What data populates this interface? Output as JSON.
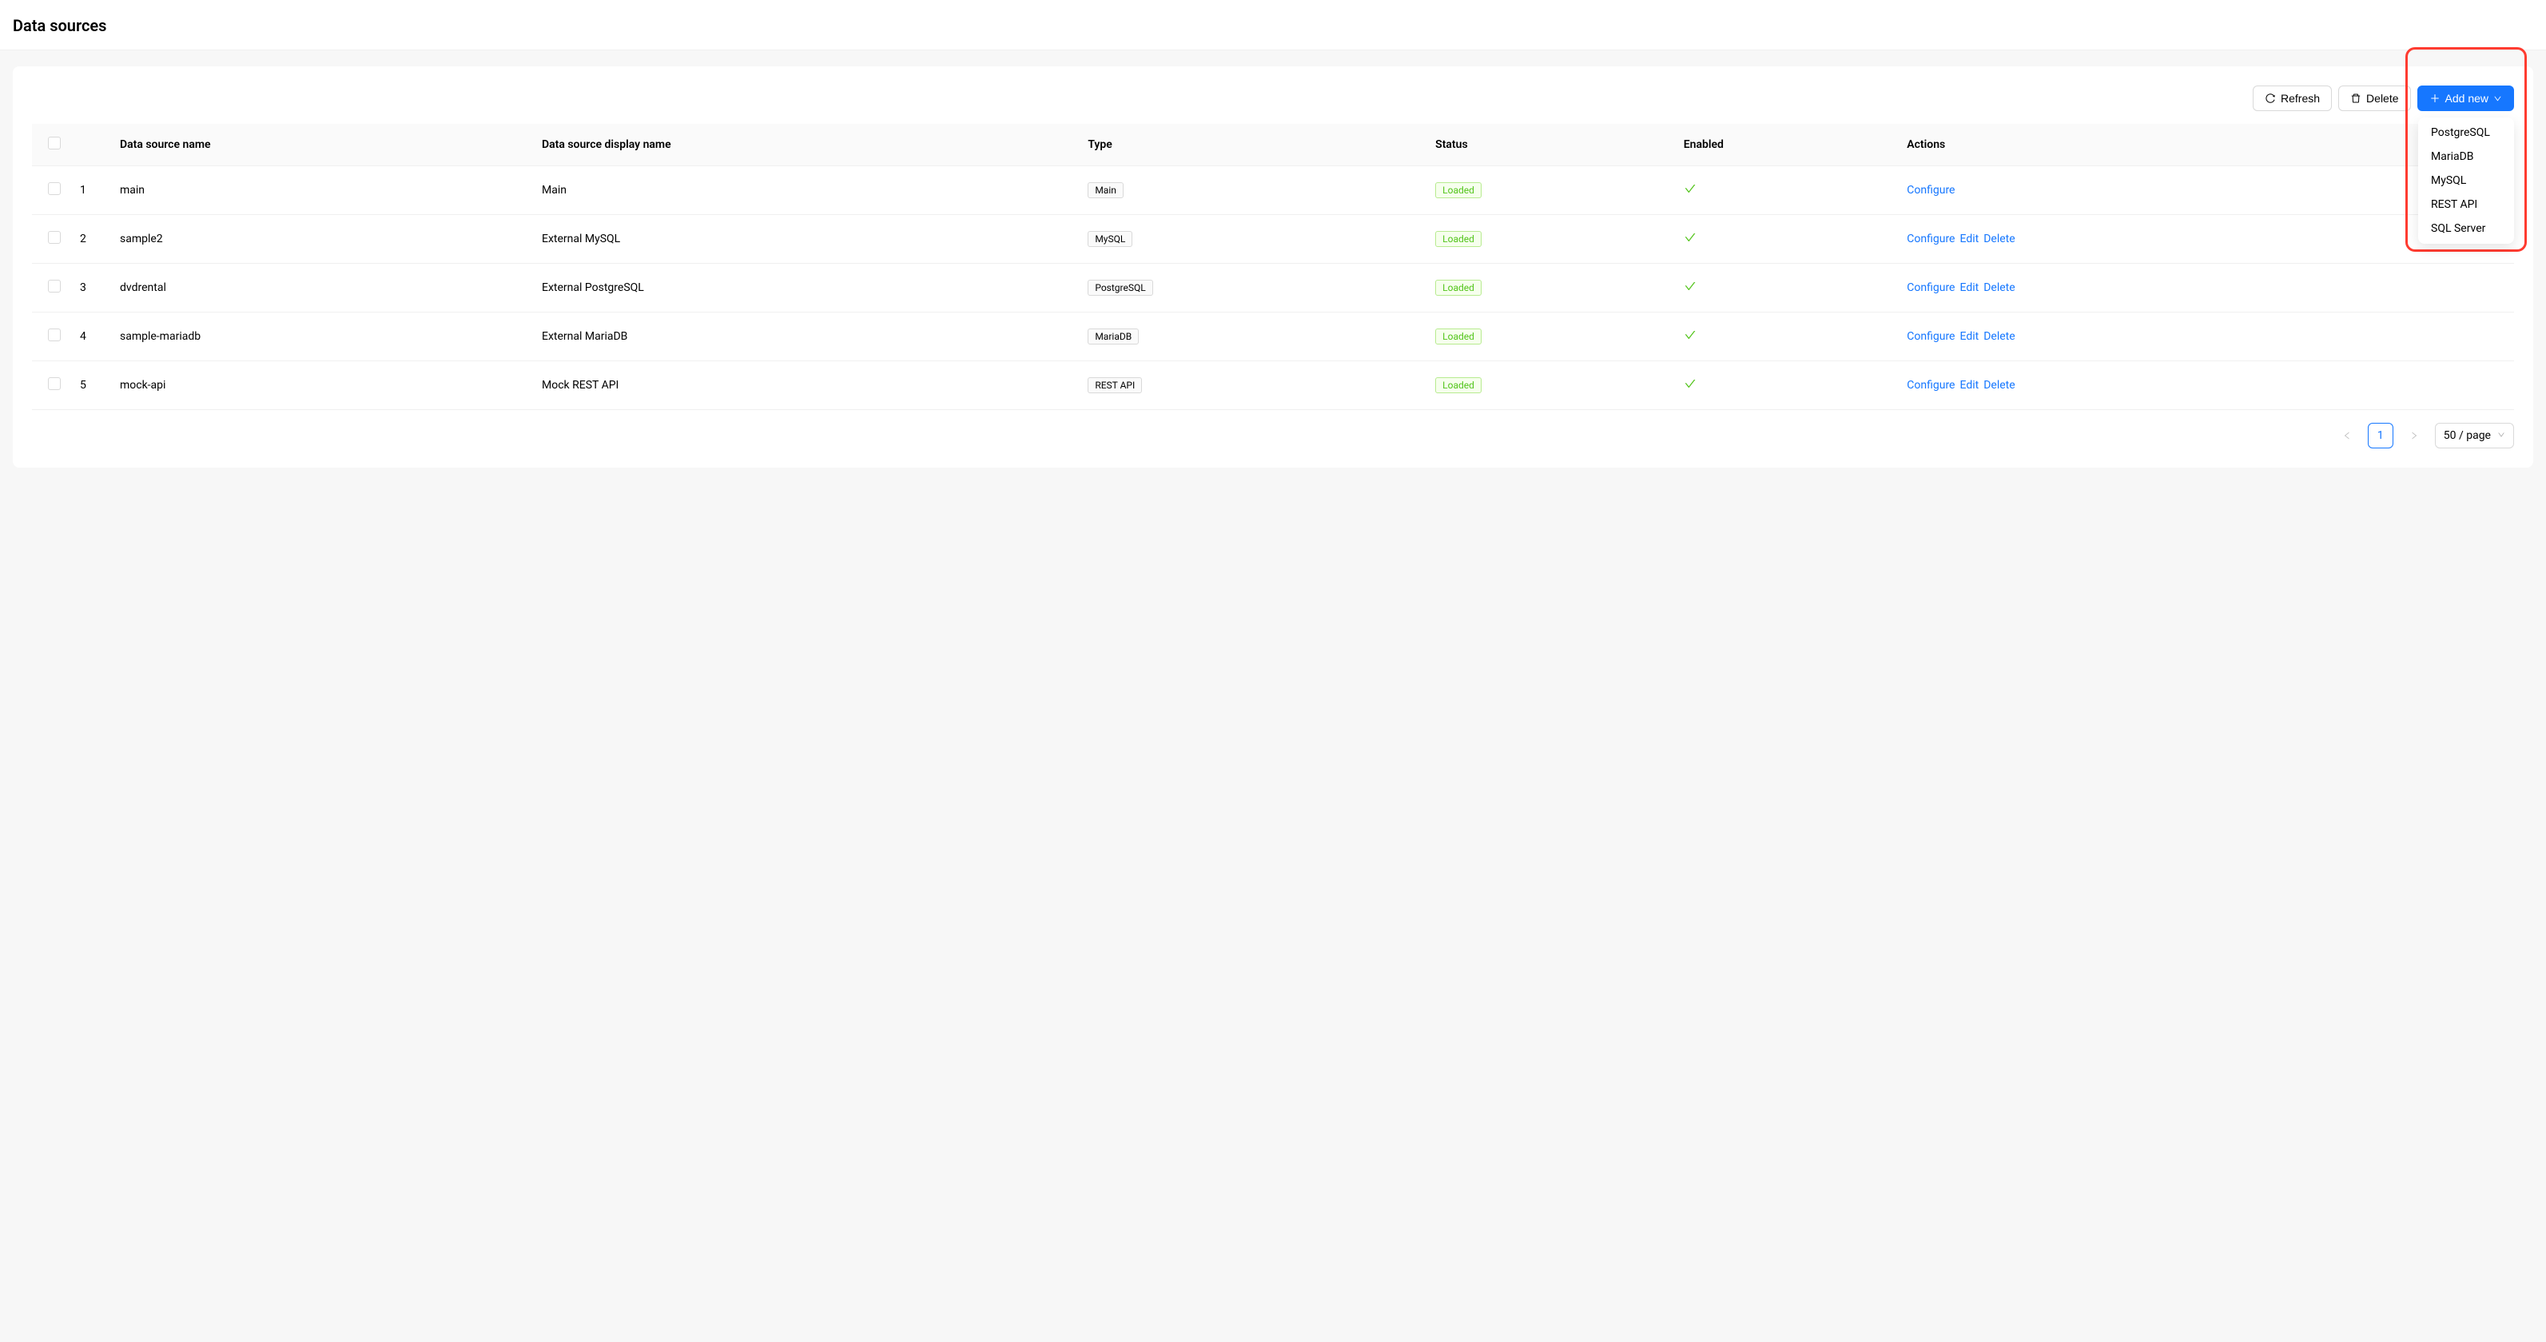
{
  "page": {
    "title": "Data sources"
  },
  "toolbar": {
    "refresh_label": "Refresh",
    "delete_label": "Delete",
    "add_new_label": "Add new"
  },
  "dropdown": {
    "items": [
      "PostgreSQL",
      "MariaDB",
      "MySQL",
      "REST API",
      "SQL Server"
    ]
  },
  "table": {
    "headers": {
      "name": "Data source name",
      "display": "Data source display name",
      "type": "Type",
      "status": "Status",
      "enabled": "Enabled",
      "actions": "Actions"
    },
    "rows": [
      {
        "idx": "1",
        "name": "main",
        "display": "Main",
        "type": "Main",
        "status": "Loaded",
        "enabled": true,
        "actions": [
          "Configure"
        ]
      },
      {
        "idx": "2",
        "name": "sample2",
        "display": "External MySQL",
        "type": "MySQL",
        "status": "Loaded",
        "enabled": true,
        "actions": [
          "Configure",
          "Edit",
          "Delete"
        ]
      },
      {
        "idx": "3",
        "name": "dvdrental",
        "display": "External PostgreSQL",
        "type": "PostgreSQL",
        "status": "Loaded",
        "enabled": true,
        "actions": [
          "Configure",
          "Edit",
          "Delete"
        ]
      },
      {
        "idx": "4",
        "name": "sample-mariadb",
        "display": "External MariaDB",
        "type": "MariaDB",
        "status": "Loaded",
        "enabled": true,
        "actions": [
          "Configure",
          "Edit",
          "Delete"
        ]
      },
      {
        "idx": "5",
        "name": "mock-api",
        "display": "Mock REST API",
        "type": "REST API",
        "status": "Loaded",
        "enabled": true,
        "actions": [
          "Configure",
          "Edit",
          "Delete"
        ]
      }
    ]
  },
  "pagination": {
    "current": "1",
    "page_size_label": "50 / page"
  }
}
